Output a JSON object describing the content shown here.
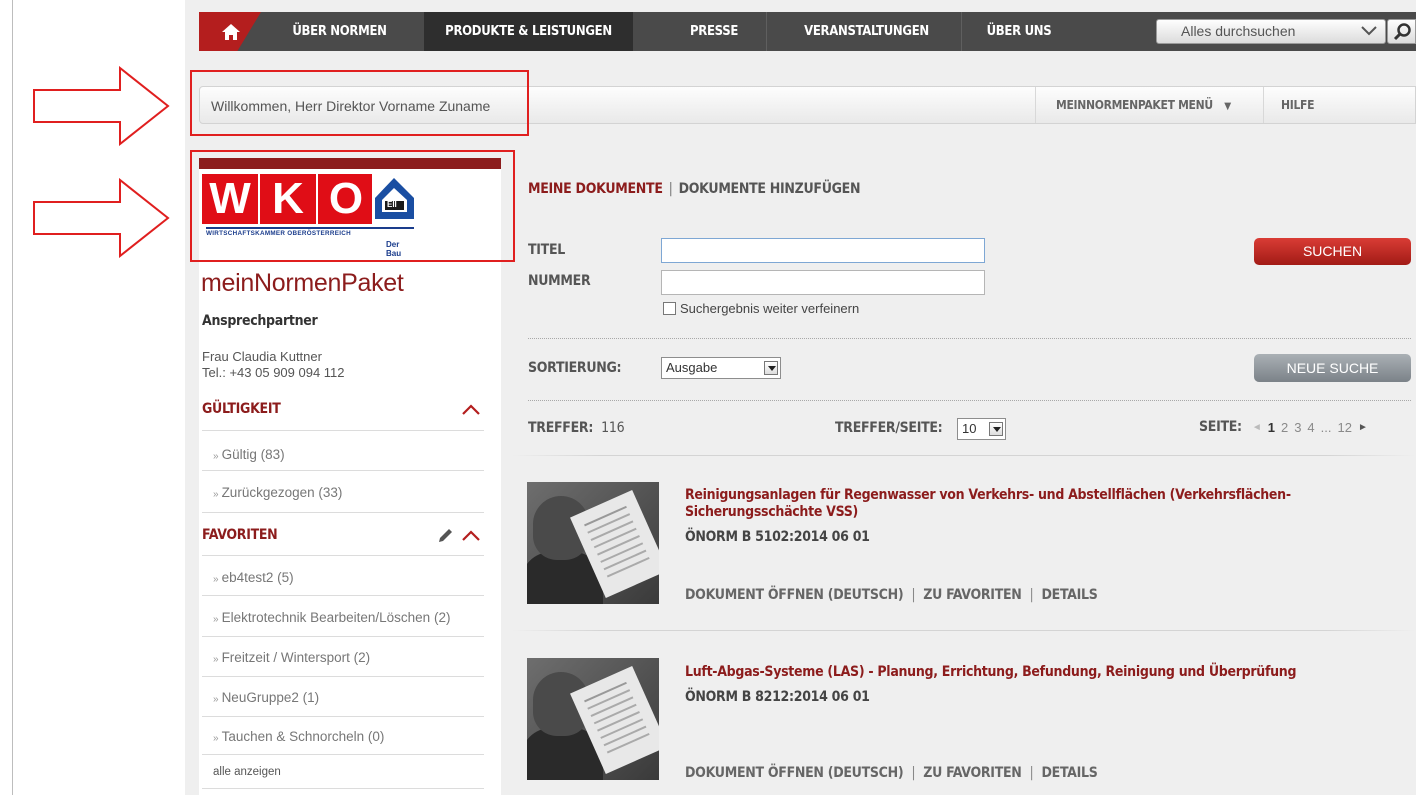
{
  "nav": {
    "items": [
      {
        "label": "ÜBER NORMEN"
      },
      {
        "label": "PRODUKTE & LEISTUNGEN"
      },
      {
        "label": "PRESSE"
      },
      {
        "label": "VERANSTALTUNGEN"
      },
      {
        "label": "ÜBER UNS"
      }
    ],
    "search_placeholder": "Alles durchsuchen",
    "colors": {
      "bar": "#4a4a4a",
      "active": "#2e2e2e",
      "home": "#b41e1e"
    }
  },
  "welcome": {
    "text": "Willkommen, Herr Direktor Vorname Zuname",
    "menu_label": "MEINNORMENPAKET MENÜ",
    "menu_caret": "▼",
    "help_label": "HILFE"
  },
  "logo": {
    "letters": [
      "W",
      "K",
      "O"
    ],
    "subline": "WIRTSCHAFTSKAMMER OBERÖSTERREICH",
    "subline2": "Der Bau",
    "house_text": "EII"
  },
  "sidebar": {
    "title": "meinNormenPaket",
    "contact_head": "Ansprechpartner",
    "contact_name": "Frau Claudia Kuttner",
    "contact_phone": "Tel.: +43 05 909 094 112",
    "validity_head": "GÜLTIGKEIT",
    "validity_items": [
      "Gültig (83)",
      "Zurückgezogen (33)"
    ],
    "favorites_head": "FAVORITEN",
    "favorite_items": [
      "eb4test2 (5)",
      "Elektrotechnik Bearbeiten/Löschen (2)",
      "Freitzeit / Wintersport (2)",
      "NeuGruppe2 (1)",
      "Tauchen & Schnorcheln (0)"
    ],
    "show_all": "alle anzeigen",
    "bullet": "»"
  },
  "main": {
    "tab_active": "MEINE DOKUMENTE",
    "tab_sep": "|",
    "tab_other": "DOKUMENTE HINZUFÜGEN",
    "label_title": "TITEL",
    "label_number": "NUMMER",
    "title_value": "",
    "number_value": "",
    "refine_label": "Suchergebnis weiter verfeinern",
    "search_button": "SUCHEN",
    "sort_label": "SORTIERUNG:",
    "sort_value": "Ausgabe",
    "new_search_button": "NEUE SUCHE",
    "hits_label": "TREFFER:",
    "hits_value": "116",
    "per_page_label": "TREFFER/SEITE:",
    "per_page_value": "10",
    "page_label": "SEITE:",
    "pages": [
      "1",
      "2",
      "3",
      "4",
      "...",
      "12"
    ],
    "current_page": "1",
    "prev_arrow": "◄",
    "next_arrow": "►"
  },
  "results": [
    {
      "title": "Reinigungsanlagen für Regenwasser von Verkehrs- und Abstellflächen (Verkehrsflächen-Sicherungsschächte VSS)",
      "norm": "ÖNORM B 5102:2014 06 01",
      "link_open": "DOKUMENT ÖFFNEN (DEUTSCH)",
      "link_fav": "ZU FAVORITEN",
      "link_details": "DETAILS"
    },
    {
      "title": "Luft-Abgas-Systeme (LAS) - Planung, Errichtung, Befundung, Reinigung und Überprüfung",
      "norm": "ÖNORM B 8212:2014 06 01",
      "link_open": "DOKUMENT ÖFFNEN (DEUTSCH)",
      "link_fav": "ZU FAVORITEN",
      "link_details": "DETAILS"
    }
  ],
  "link_sep": "|",
  "annotation_color": "#e01f1f"
}
